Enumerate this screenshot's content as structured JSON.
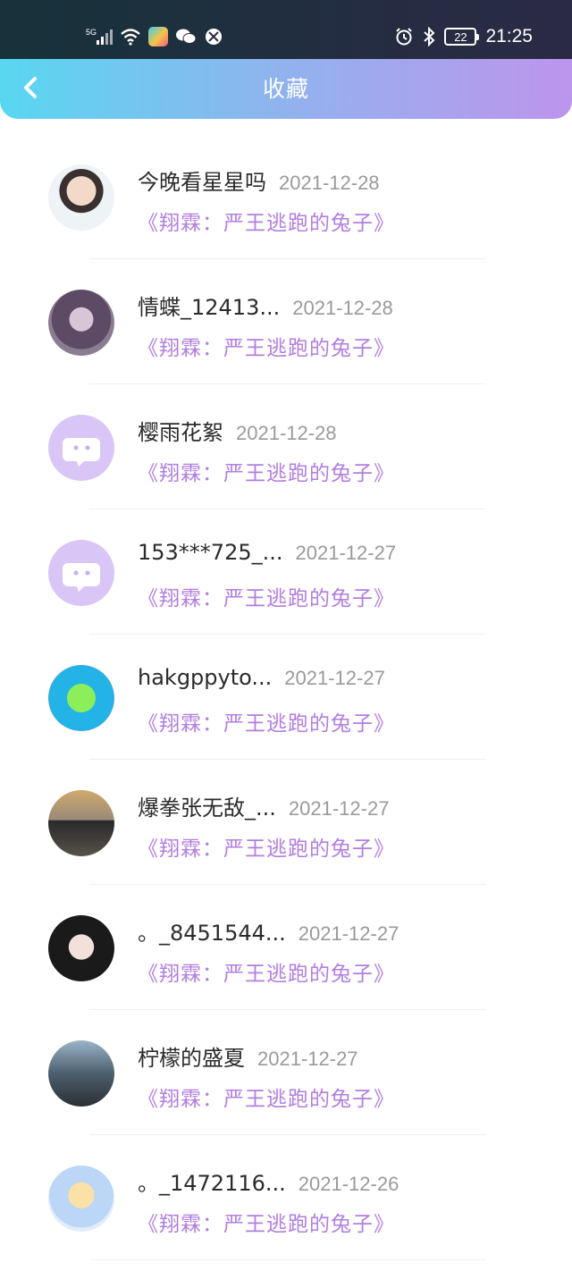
{
  "status_bar": {
    "network": "5G",
    "battery": "22",
    "time": "21:25"
  },
  "header": {
    "title": "收藏"
  },
  "items": [
    {
      "name": "今晚看星星吗",
      "date": "2021-12-28",
      "book": "《翔霖：严王逃跑的兔子》",
      "avatar": "avatar-photo"
    },
    {
      "name": "情蝶_12413...",
      "date": "2021-12-28",
      "book": "《翔霖：严王逃跑的兔子》",
      "avatar": "avatar-photo"
    },
    {
      "name": "樱雨花絮",
      "date": "2021-12-28",
      "book": "《翔霖：严王逃跑的兔子》",
      "avatar": "default-avatar-icon"
    },
    {
      "name": "153***725_...",
      "date": "2021-12-27",
      "book": "《翔霖：严王逃跑的兔子》",
      "avatar": "default-avatar-icon"
    },
    {
      "name": "hakgppyto...",
      "date": "2021-12-27",
      "book": "《翔霖：严王逃跑的兔子》",
      "avatar": "avatar-photo"
    },
    {
      "name": "爆拳张无敌_...",
      "date": "2021-12-27",
      "book": "《翔霖：严王逃跑的兔子》",
      "avatar": "avatar-photo"
    },
    {
      "name": "。_8451544...",
      "date": "2021-12-27",
      "book": "《翔霖：严王逃跑的兔子》",
      "avatar": "avatar-photo"
    },
    {
      "name": "柠檬的盛夏",
      "date": "2021-12-27",
      "book": "《翔霖：严王逃跑的兔子》",
      "avatar": "avatar-photo"
    },
    {
      "name": "。_1472116...",
      "date": "2021-12-26",
      "book": "《翔霖：严王逃跑的兔子》",
      "avatar": "avatar-photo"
    }
  ]
}
